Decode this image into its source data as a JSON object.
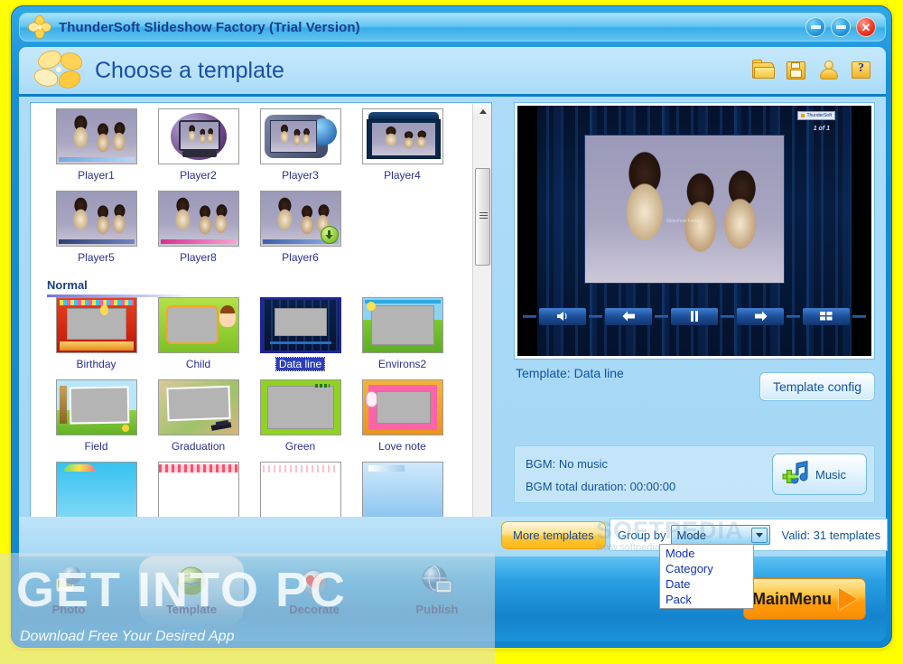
{
  "window": {
    "title": "ThunderSoft Slideshow Factory (Trial Version)",
    "minimize_label": "–",
    "maximize_label": "–",
    "close_label": "✕"
  },
  "header": {
    "title": "Choose a template",
    "icons": [
      {
        "name": "open-folder-icon",
        "tooltip": "Open"
      },
      {
        "name": "save-icon",
        "tooltip": "Save"
      },
      {
        "name": "user-icon",
        "tooltip": "User"
      },
      {
        "name": "help-icon",
        "tooltip": "Help",
        "glyph": "?"
      }
    ]
  },
  "templates": {
    "groups": [
      {
        "heading": null,
        "items": [
          {
            "label": "Player1",
            "style": "player1",
            "selected": false,
            "badge": null
          },
          {
            "label": "Player2",
            "style": "player2",
            "selected": false,
            "badge": null
          },
          {
            "label": "Player3",
            "style": "player3",
            "selected": false,
            "badge": null
          },
          {
            "label": "Player4",
            "style": "player4",
            "selected": false,
            "badge": null
          },
          {
            "label": "Player5",
            "style": "player5",
            "selected": false,
            "badge": null
          },
          {
            "label": "Player8",
            "style": "player8",
            "selected": false,
            "badge": null
          },
          {
            "label": "Player6",
            "style": "player6",
            "selected": false,
            "badge": "download"
          }
        ]
      },
      {
        "heading": "Normal",
        "items": [
          {
            "label": "Birthday",
            "style": "birthday",
            "selected": false,
            "badge": null
          },
          {
            "label": "Child",
            "style": "child",
            "selected": false,
            "badge": null
          },
          {
            "label": "Data line",
            "style": "dataline",
            "selected": true,
            "badge": null
          },
          {
            "label": "Environs2",
            "style": "environs2",
            "selected": false,
            "badge": null
          },
          {
            "label": "Field",
            "style": "field",
            "selected": false,
            "badge": null
          },
          {
            "label": "Graduation",
            "style": "graduation",
            "selected": false,
            "badge": null
          },
          {
            "label": "Green",
            "style": "green",
            "selected": false,
            "badge": null
          },
          {
            "label": "Love note",
            "style": "lovenote",
            "selected": false,
            "badge": null
          }
        ]
      }
    ],
    "partial_row": [
      {
        "style": "partial-a"
      },
      {
        "style": "partial-b"
      },
      {
        "style": "partial-c"
      },
      {
        "style": "partial-d"
      }
    ]
  },
  "scrollbar": {
    "up_arrow": "▲",
    "down_arrow": "▼"
  },
  "preview": {
    "watermark_badge": "ThunderSoft",
    "slide_counter": "1 of 1",
    "photo_watermark": "Slideshow Factory",
    "controls": [
      {
        "name": "volume-button",
        "icon": "volume-icon"
      },
      {
        "name": "previous-button",
        "icon": "arrow-left-icon"
      },
      {
        "name": "pause-button",
        "icon": "pause-icon"
      },
      {
        "name": "next-button",
        "icon": "arrow-right-icon"
      },
      {
        "name": "thumbnails-button",
        "icon": "grid-icon"
      }
    ]
  },
  "template_info": {
    "name_label": "Template: Data line",
    "config_button": "Template config"
  },
  "bgm": {
    "status": "BGM: No music",
    "duration": "BGM total duration: 00:00:00",
    "music_button": "Music"
  },
  "toolbar_bottom": {
    "more_templates": "More templates",
    "group_by_label": "Group by",
    "group_by_value": "Mode",
    "group_by_options": [
      "Mode",
      "Category",
      "Date",
      "Pack"
    ],
    "valid_text": "Valid: 31 templates"
  },
  "nav": {
    "items": [
      {
        "label": "Photo",
        "icon": "photo-icon",
        "active": false
      },
      {
        "label": "Template",
        "icon": "template-icon",
        "active": true
      },
      {
        "label": "Decorate",
        "icon": "decorate-icon",
        "active": false
      },
      {
        "label": "Publish",
        "icon": "publish-icon",
        "active": false
      }
    ],
    "main_menu": "MainMenu"
  },
  "watermarks": {
    "getintopc_big": "GET INTO PC",
    "getintopc_sub": "Download Free Your Desired App",
    "softpedia_line1": "SOFTPEDIA",
    "softpedia_line2": "www.softpedia.com"
  },
  "colors": {
    "frame_outer": "#ffff00",
    "frame_blue": "#1a8ed4",
    "accent_orange": "#ffb714",
    "selection_blue": "#2b3fbe",
    "text_blue": "#11539b"
  }
}
